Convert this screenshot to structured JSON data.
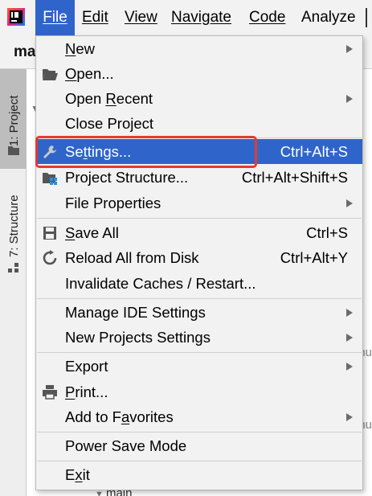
{
  "menubar": {
    "items": [
      {
        "label": "File",
        "mnemonic_index": 0
      },
      {
        "label": "Edit",
        "mnemonic_index": 0
      },
      {
        "label": "View",
        "mnemonic_index": 0
      },
      {
        "label": "Navigate",
        "mnemonic_index": 0
      },
      {
        "label": "Code",
        "mnemonic_index": 0
      },
      {
        "label": "Analyze",
        "mnemonic_index": -1
      }
    ]
  },
  "project_tab": {
    "label": "ma"
  },
  "toolstrip": {
    "project": "1: Project",
    "structure": "7: Structure"
  },
  "background": {
    "nu_text": "nu",
    "main_text": "main"
  },
  "file_menu": {
    "items": [
      {
        "label": "New",
        "u": "N",
        "rest": "ew",
        "shortcut": "",
        "submenu": true
      },
      {
        "label": "Open...",
        "u": "O",
        "rest": "pen...",
        "shortcut": "",
        "submenu": false
      },
      {
        "label": "Open Recent",
        "pre": "Open ",
        "u": "R",
        "rest": "ecent",
        "shortcut": "",
        "submenu": true
      },
      {
        "label": "Close Project",
        "shortcut": "",
        "submenu": false
      },
      {
        "label": "Settings...",
        "pre": "Se",
        "u": "t",
        "rest": "tings...",
        "shortcut": "Ctrl+Alt+S",
        "submenu": false
      },
      {
        "label": "Project Structure...",
        "shortcut": "Ctrl+Alt+Shift+S",
        "submenu": false
      },
      {
        "label": "File Properties",
        "shortcut": "",
        "submenu": true
      },
      {
        "label": "Save All",
        "u": "S",
        "rest": "ave All",
        "shortcut": "Ctrl+S",
        "submenu": false
      },
      {
        "label": "Reload All from Disk",
        "shortcut": "Ctrl+Alt+Y",
        "submenu": false
      },
      {
        "label": "Invalidate Caches / Restart...",
        "shortcut": "",
        "submenu": false
      },
      {
        "label": "Manage IDE Settings",
        "shortcut": "",
        "submenu": true
      },
      {
        "label": "New Projects Settings",
        "shortcut": "",
        "submenu": true
      },
      {
        "label": "Export",
        "shortcut": "",
        "submenu": true
      },
      {
        "label": "Print...",
        "u": "P",
        "rest": "rint...",
        "shortcut": "",
        "submenu": false
      },
      {
        "label": "Add to Favorites",
        "pre": "Add to F",
        "u": "a",
        "rest": "vorites",
        "shortcut": "",
        "submenu": true
      },
      {
        "label": "Power Save Mode",
        "shortcut": "",
        "submenu": false
      },
      {
        "label": "Exit",
        "pre": "E",
        "u": "x",
        "rest": "it",
        "shortcut": "",
        "submenu": false
      }
    ]
  },
  "colors": {
    "selection": "#2f65ca",
    "highlight_box": "#e23b32",
    "menu_bg": "#f2f2f2"
  }
}
